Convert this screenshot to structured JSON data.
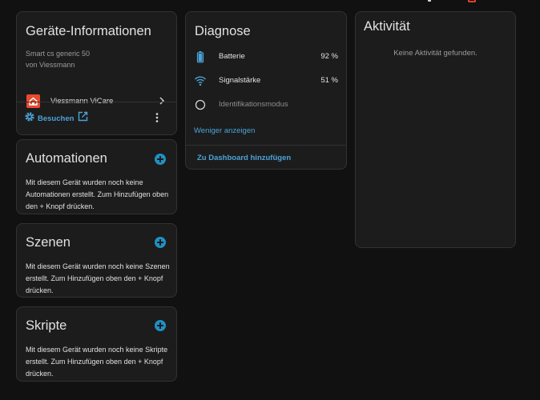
{
  "device_info": {
    "title": "Geräte-Informationen",
    "model": "Smart cs generic 50",
    "manufacturer": "von Viessmann",
    "integration": "Viessmann ViCare",
    "visit_label": "Besuchen"
  },
  "automations": {
    "title": "Automationen",
    "text": "Mit diesem Gerät wurden noch keine Automationen erstellt. Zum Hinzufügen oben den + Knopf drücken."
  },
  "scenes": {
    "title": "Szenen",
    "text": "Mit diesem Gerät wurden noch keine Szenen erstellt. Zum Hinzufügen oben den + Knopf drücken."
  },
  "scripts": {
    "title": "Skripte",
    "text": "Mit diesem Gerät wurden noch keine Skripte erstellt. Zum Hinzufügen oben den + Knopf drücken."
  },
  "diagnostics": {
    "title": "Diagnose",
    "rows": [
      {
        "icon": "battery-icon",
        "label": "Batterie",
        "value": "92 %"
      },
      {
        "icon": "wifi-icon",
        "label": "Signalstärke",
        "value": "51 %"
      },
      {
        "icon": "circle-outline-icon",
        "label": "Identifikationsmodus",
        "value": ""
      }
    ],
    "show_less": "Weniger anzeigen",
    "add_to_dashboard": "Zu Dashboard hinzufügen"
  },
  "activity": {
    "title": "Aktivität",
    "empty": "Keine Aktivität gefunden."
  },
  "colors": {
    "background": "#111111",
    "card": "#1c1c1c",
    "accent": "#4ba3d8",
    "brand_viessmann": "#e94a2e"
  }
}
